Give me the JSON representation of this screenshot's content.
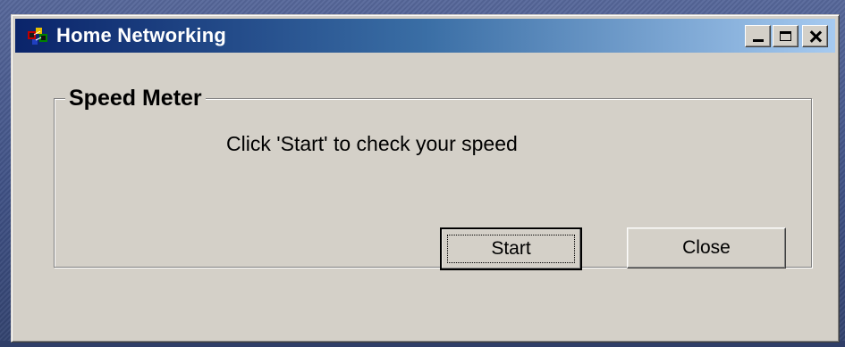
{
  "window": {
    "title": "Home Networking",
    "icon": "home-networking-icon",
    "controls": {
      "minimize_icon": "minimize-icon",
      "maximize_icon": "maximize-icon",
      "close_icon": "close-icon"
    }
  },
  "speed_meter": {
    "group_label": "Speed Meter",
    "instruction": "Click 'Start' to check your speed",
    "start_label": "Start",
    "close_label": "Close"
  },
  "colors": {
    "titlebar_start": "#0a246a",
    "titlebar_end": "#a6caf0",
    "face": "#d4d0c8"
  }
}
